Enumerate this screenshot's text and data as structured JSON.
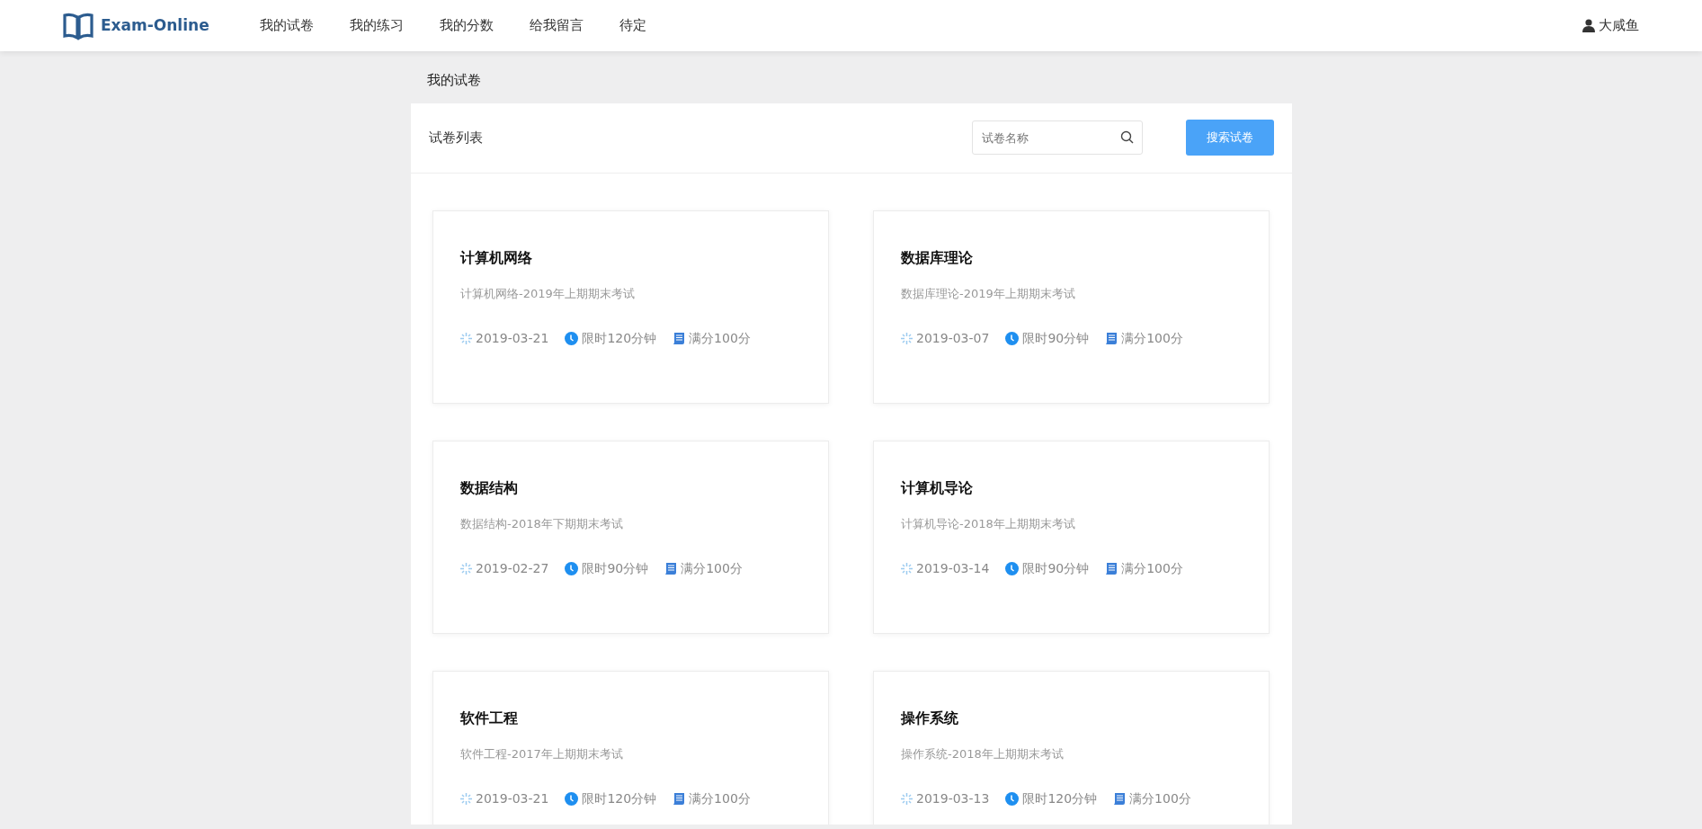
{
  "navbar": {
    "brand": "Exam-Online",
    "items": [
      "我的试卷",
      "我的练习",
      "我的分数",
      "给我留言",
      "待定"
    ],
    "user": "大咸鱼"
  },
  "breadcrumb": "我的试卷",
  "panel": {
    "title": "试卷列表",
    "search": {
      "placeholder": "试卷名称"
    },
    "button": "搜索试卷"
  },
  "papers": [
    {
      "title": "计算机网络",
      "description": "计算机网络-2019年上期期末考试",
      "date": "2019-03-21",
      "time_limit": "限时120分钟",
      "full_score": "满分100分"
    },
    {
      "title": "数据库理论",
      "description": "数据库理论-2019年上期期末考试",
      "date": "2019-03-07",
      "time_limit": "限时90分钟",
      "full_score": "满分100分"
    },
    {
      "title": "数据结构",
      "description": "数据结构-2018年下期期末考试",
      "date": "2019-02-27",
      "time_limit": "限时90分钟",
      "full_score": "满分100分"
    },
    {
      "title": "计算机导论",
      "description": "计算机导论-2018年上期期末考试",
      "date": "2019-03-14",
      "time_limit": "限时90分钟",
      "full_score": "满分100分"
    },
    {
      "title": "软件工程",
      "description": "软件工程-2017年上期期末考试",
      "date": "2019-03-21",
      "time_limit": "限时120分钟",
      "full_score": "满分100分"
    },
    {
      "title": "操作系统",
      "description": "操作系统-2018年上期期末考试",
      "date": "2019-03-13",
      "time_limit": "限时120分钟",
      "full_score": "满分100分"
    }
  ]
}
